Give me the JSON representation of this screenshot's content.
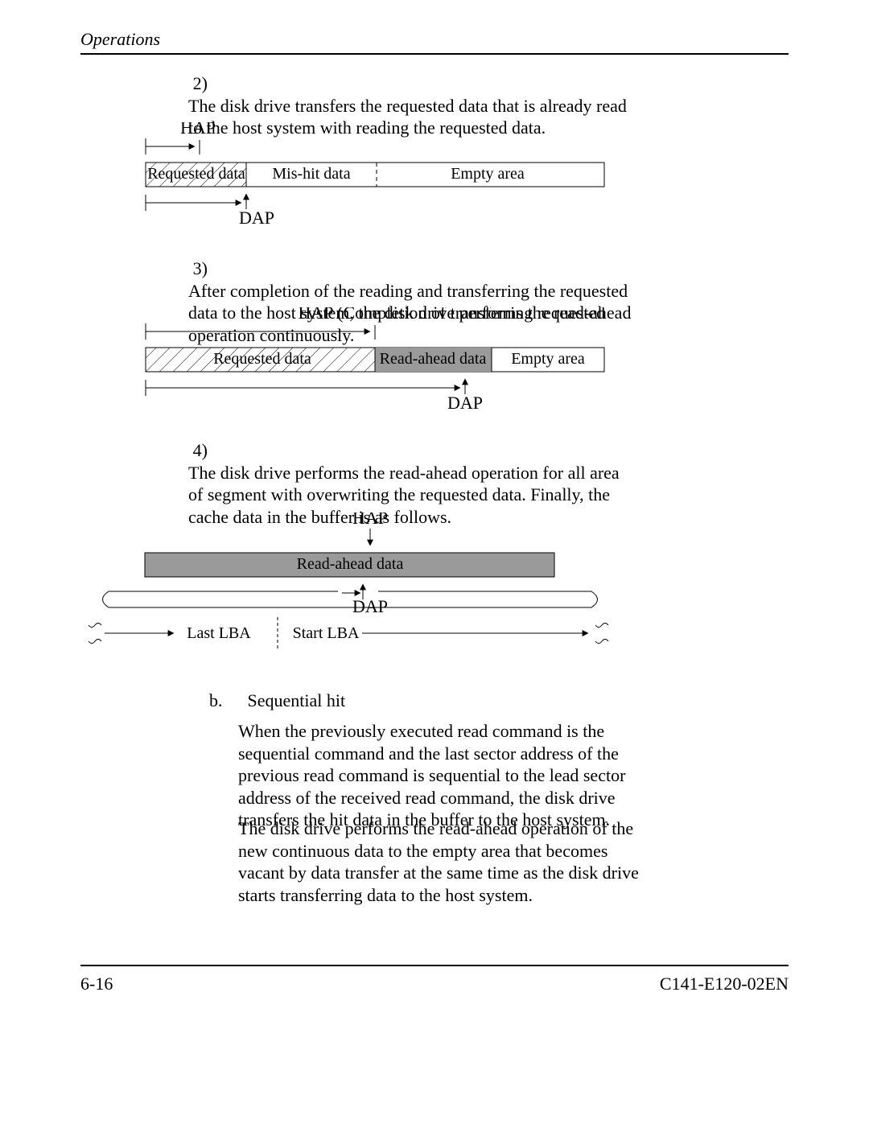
{
  "header": {
    "title": "Operations"
  },
  "items": {
    "i2": {
      "num": "2)",
      "text": "The disk drive transfers the requested data that is already read to the host system with reading the requested data."
    },
    "i3": {
      "num": "3)",
      "text": "After completion of the reading and transferring the requested data to the host system, the disk drive performs the read-ahead operation continuously."
    },
    "i4": {
      "num": "4)",
      "text": "The disk drive performs the read-ahead operation for all area of segment with overwriting the requested data.  Finally, the cache data in the buffer is as follows."
    },
    "b": {
      "num": "b.",
      "text": "Sequential hit"
    },
    "b_p1": "When the previously executed read command is the sequential command and the last sector address of the previous read command is sequential to the lead sector address of the received read command, the disk drive transfers the hit data in the buffer to the host system.",
    "b_p2": "The disk drive performs the read-ahead operation of the new continuous data to the empty area that becomes vacant by data transfer at the same time as the disk drive starts transferring data to the host system."
  },
  "diag1": {
    "hap": "HAP",
    "dap": "DAP",
    "requested": "Requested data",
    "mishit": "Mis-hit data",
    "empty": "Empty area"
  },
  "diag2": {
    "hap": "HAP (Completion of transferring requested data)",
    "dap": "DAP",
    "requested": "Requested data",
    "readahead": "Read-ahead data",
    "empty": "Empty area"
  },
  "diag3": {
    "hap": "HAP",
    "dap": "DAP",
    "readahead": "Read-ahead data",
    "lastlba": "Last LBA",
    "startlba": "Start LBA"
  },
  "footer": {
    "left": "6-16",
    "right": "C141-E120-02EN"
  }
}
